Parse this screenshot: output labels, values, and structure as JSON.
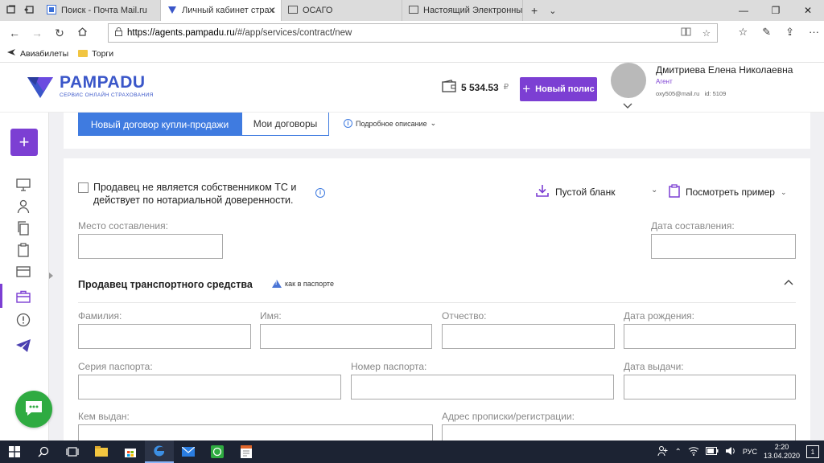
{
  "browser": {
    "tabs": [
      {
        "title": "Поиск - Почта Mail.ru",
        "active": false
      },
      {
        "title": "Личный кабинет страх",
        "active": true
      },
      {
        "title": "ОСАГО",
        "active": false
      },
      {
        "title": "Настоящий Электронный Г",
        "active": false
      }
    ],
    "url_host": "https://agents.pampadu.ru",
    "url_path": "/#/app/services/contract/new",
    "bookmarks": [
      {
        "label": "Авиабилеты",
        "icon": "plane-icon"
      },
      {
        "label": "Торги",
        "icon": "folder-icon"
      }
    ]
  },
  "app": {
    "logo_text": "PAMPADU",
    "logo_subtitle": "СЕРВИС ОНЛАЙН СТРАХОВАНИЯ",
    "balance": "5 534.53",
    "currency": "₽",
    "new_policy_label": "Новый полис",
    "user_name": "Дмитриева Елена Николаевна",
    "user_role": "Агент",
    "user_email": "oxy505@mail.ru",
    "user_id": "id: 5109",
    "accent_color": "#7c3fd3",
    "tab_primary_color": "#3f7be0"
  },
  "tabs": {
    "new_contract": "Новый договор купли-продажи",
    "my_contracts": "Мои договоры",
    "details": "Подробное описание"
  },
  "form": {
    "seller_not_owner": "Продавец не является собственником ТС и действует по нотариальной доверенности.",
    "blank_link": "Пустой бланк",
    "example_link": "Посмотреть пример",
    "place_label": "Место составления:",
    "date_label": "Дата составления:",
    "seller_section": "Продавец транспортного средства",
    "as_in_passport": "как в паспорте",
    "last_name": "Фамилия:",
    "first_name": "Имя:",
    "patronymic": "Отчество:",
    "birth_date": "Дата рождения:",
    "passport_series": "Серия паспорта:",
    "passport_number": "Номер паспорта:",
    "issue_date": "Дата выдачи:",
    "issued_by": "Кем выдан:",
    "address": "Адрес прописки/регистрации:"
  },
  "taskbar": {
    "language": "РУС",
    "time": "2:20",
    "date": "13.04.2020",
    "notification_count": "1"
  }
}
